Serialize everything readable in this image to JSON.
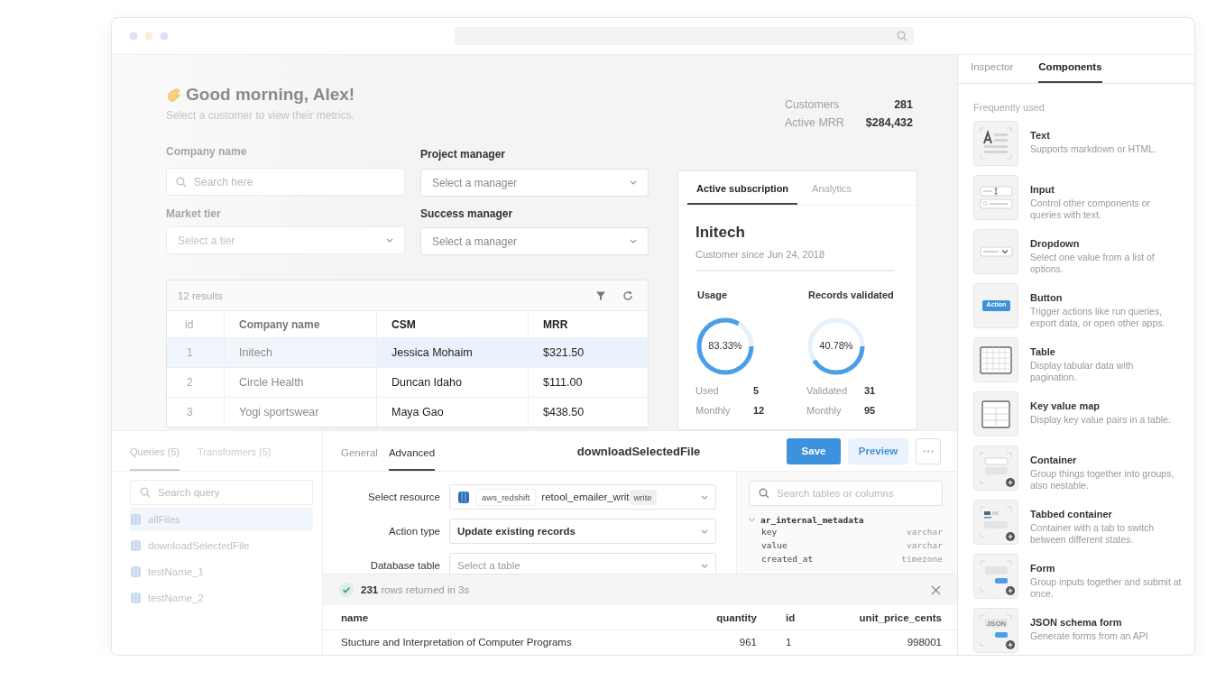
{
  "greeting": {
    "title": "Good morning, Alex!",
    "subtitle": "Select a customer to view their metrics."
  },
  "stats": [
    {
      "label": "Customers",
      "value": "281"
    },
    {
      "label": "Active MRR",
      "value": "$284,432"
    }
  ],
  "filters": [
    {
      "label": "Company name",
      "placeholder": "Search here",
      "kind": "search"
    },
    {
      "label": "Project manager",
      "placeholder": "Select a manager",
      "kind": "select"
    },
    {
      "label": "Market tier",
      "placeholder": "Select a tier",
      "kind": "select"
    },
    {
      "label": "Success manager",
      "placeholder": "Select a manager",
      "kind": "select"
    }
  ],
  "table": {
    "count": "12 results",
    "columns": [
      "id",
      "Company name",
      "CSM",
      "MRR"
    ],
    "rows": [
      {
        "cells": [
          "1",
          "Initech",
          "Jessica Mohaim",
          "$321.50"
        ],
        "selected": true
      },
      {
        "cells": [
          "2",
          "Circle Health",
          "Duncan Idaho",
          "$111.00"
        ],
        "selected": false
      },
      {
        "cells": [
          "3",
          "Yogi sportswear",
          "Maya Gao",
          "$438.50"
        ],
        "selected": false
      }
    ]
  },
  "card": {
    "tabs": [
      {
        "label": "Active subscription",
        "selected": true
      },
      {
        "label": "Analytics",
        "selected": false
      }
    ],
    "title": "Initech",
    "subtitle": "Customer since Jun 24, 2018",
    "metrics": [
      {
        "label": "Usage",
        "level": 0.8333,
        "reading": "83.33%",
        "rows": [
          {
            "label": "Used",
            "value": "5"
          },
          {
            "label": "Monthly",
            "value": "12"
          }
        ]
      },
      {
        "label": "Records validated",
        "level": 0.4078,
        "reading": "40.78%",
        "rows": [
          {
            "label": "Validated",
            "value": "31"
          },
          {
            "label": "Monthly",
            "value": "95"
          }
        ]
      }
    ]
  },
  "query_sidebar": {
    "tabs": [
      {
        "label": "Queries (5)",
        "selected": true
      },
      {
        "label": "Transformers (5)",
        "selected": false
      }
    ],
    "search": {
      "placeholder": "Search query"
    },
    "items": [
      {
        "label": "allFiles",
        "selected": true
      },
      {
        "label": "downloadSelectedFile",
        "selected": false
      },
      {
        "label": "testName_1",
        "selected": false
      },
      {
        "label": "testName_2",
        "selected": false
      }
    ]
  },
  "editor": {
    "tabs": [
      {
        "label": "General",
        "selected": false
      },
      {
        "label": "Advanced",
        "selected": true
      }
    ],
    "title": "downloadSelectedFile",
    "buttons": [
      {
        "label": "Save",
        "kind": "primary"
      },
      {
        "label": "Preview",
        "kind": "secondary"
      },
      {
        "kind": "more"
      }
    ],
    "fields": [
      {
        "label": "Select resource",
        "kind": "resource",
        "tag": "aws_redshift",
        "value": "retool_emailer_writ",
        "badge": "write"
      },
      {
        "label": "Action type",
        "kind": "select",
        "value": "Update existing records"
      },
      {
        "label": "Database table",
        "kind": "select",
        "placeholder": "Select a table"
      }
    ]
  },
  "schema": {
    "search": {
      "placeholder": "Search tables or columns"
    },
    "tables": [
      {
        "name": "ar_internal_metadata",
        "expanded": true,
        "children": [
          {
            "name": "key",
            "type": "varchar"
          },
          {
            "name": "value",
            "type": "varchar"
          },
          {
            "name": "created_at",
            "type": "timezone"
          }
        ]
      }
    ]
  },
  "results": {
    "count": "231",
    "message": "rows returned in 3s",
    "columns": [
      "name",
      "quantity",
      "id",
      "unit_price_cents"
    ],
    "rows": [
      [
        "Stucture and Interpretation of Computer Programs",
        "961",
        "1",
        "998001"
      ]
    ]
  },
  "inspector": {
    "tabs": [
      {
        "label": "Inspector",
        "selected": false
      },
      {
        "label": "Components",
        "selected": true
      }
    ],
    "section": "Frequently used",
    "components": [
      {
        "kind": "text",
        "title": "Text",
        "description": "Supports markdown or HTML."
      },
      {
        "kind": "input",
        "title": "Input",
        "description": "Control other components or queries with text."
      },
      {
        "kind": "dropdown",
        "title": "Dropdown",
        "description": "Select one value from a list of options."
      },
      {
        "kind": "button",
        "title": "Button",
        "description": "Trigger actions like run queries, export data, or open other apps.",
        "icon_label": "Action"
      },
      {
        "kind": "table",
        "title": "Table",
        "description": "Display tabular data with pagination."
      },
      {
        "kind": "keyvalue",
        "title": "Key value map",
        "description": "Display key value pairs in a table."
      },
      {
        "kind": "container",
        "title": "Container",
        "description": "Group things together into groups, also nestable."
      },
      {
        "kind": "tabbed",
        "title": "Tabbed container",
        "description": "Container with a tab to switch between different states."
      },
      {
        "kind": "form",
        "title": "Form",
        "description": "Group inputs together and submit at once."
      },
      {
        "kind": "json",
        "title": "JSON schema form",
        "description": "Generate forms from an API",
        "icon_label": "JSON"
      }
    ]
  }
}
